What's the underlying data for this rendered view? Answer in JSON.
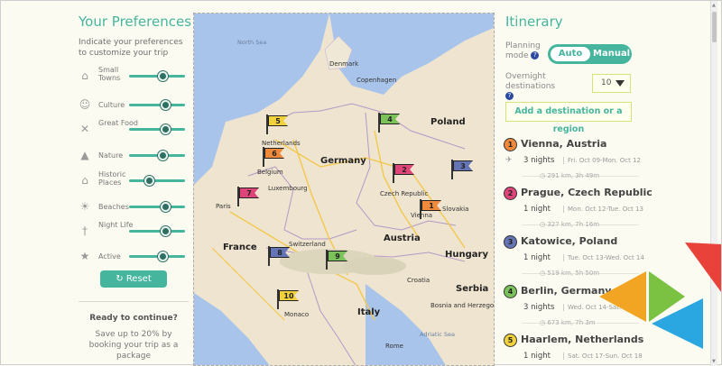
{
  "preferences": {
    "title": "Your Preferences",
    "intro": "Indicate your preferences to customize your trip",
    "items": [
      {
        "label": "Small Towns",
        "icon": "house-icon",
        "level": 0.6
      },
      {
        "label": "Culture",
        "icon": "theater-masks-icon",
        "level": 0.65
      },
      {
        "label": "Great Food",
        "icon": "fork-knife-icon",
        "level": 0.65
      },
      {
        "label": "Nature",
        "icon": "tree-icon",
        "level": 0.6
      },
      {
        "label": "Historic Places",
        "icon": "temple-icon",
        "level": 0.35
      },
      {
        "label": "Beaches",
        "icon": "beach-icon",
        "level": 0.65
      },
      {
        "label": "Night Life",
        "icon": "cocktail-icon",
        "level": 0.65
      },
      {
        "label": "Active",
        "icon": "hiking-icon",
        "level": 0.6
      }
    ],
    "reset_label": "Reset",
    "ready_title": "Ready to continue?",
    "ready_text": "Save up to 20% by booking your trip as a package"
  },
  "map": {
    "labels": {
      "north_sea": "North Sea",
      "denmark": "Denmark",
      "copenhagen": "Copenhagen",
      "poland": "Poland",
      "germany": "Germany",
      "netherlands": "Netherlands",
      "belgium": "Belgium",
      "luxembourg": "Luxembourg",
      "czech": "Czech Republic",
      "slovakia": "Slovakia",
      "france": "France",
      "switzerland": "Switzerland",
      "austria": "Austria",
      "italy": "Italy",
      "vienna": "Vienna",
      "hungary": "Hungary",
      "croatia": "Croatia",
      "bosnia": "Bosnia and Herzegovina",
      "serbia": "Serbia",
      "monaco": "Monaco",
      "rome": "Rome",
      "adriatic": "Adriatic Sea",
      "paris": "Paris"
    },
    "flags": [
      {
        "n": "1",
        "color": "#f08a3a"
      },
      {
        "n": "2",
        "color": "#e0457a"
      },
      {
        "n": "3",
        "color": "#6474b5"
      },
      {
        "n": "4",
        "color": "#7bc25a"
      },
      {
        "n": "5",
        "color": "#f2d23c"
      },
      {
        "n": "6",
        "color": "#f08a3a"
      },
      {
        "n": "7",
        "color": "#e0457a"
      },
      {
        "n": "8",
        "color": "#6474b5"
      },
      {
        "n": "9",
        "color": "#7bc25a"
      },
      {
        "n": "10",
        "color": "#f2d23c"
      }
    ]
  },
  "itinerary": {
    "title": "Itinerary",
    "planning_mode_label": "Planning mode",
    "mode_auto": "Auto",
    "mode_manual": "Manual",
    "overnight_label": "Overnight destinations",
    "overnight_value": "10",
    "add_destination": "Add a destination or a region",
    "destinations": [
      {
        "n": "1",
        "color": "#f08a3a",
        "name": "Vienna, Austria",
        "nights": "3 nights",
        "dates": "Fri. Oct 09-Mon. Oct 12",
        "dist": "291 km, 3h 49m"
      },
      {
        "n": "2",
        "color": "#e0457a",
        "name": "Prague, Czech Republic",
        "nights": "1 night",
        "dates": "Mon. Oct 12-Tue. Oct 13",
        "dist": "327 km, 7h 16m"
      },
      {
        "n": "3",
        "color": "#6474b5",
        "name": "Katowice, Poland",
        "nights": "1 night",
        "dates": "Tue. Oct 13-Wed. Oct 14",
        "dist": "519 km, 5h 50m"
      },
      {
        "n": "4",
        "color": "#7bc25a",
        "name": "Berlin, Germany",
        "nights": "3 nights",
        "dates": "Wed. Oct 14-Sat. Oct 17",
        "dist": "673 km, 7h 3m"
      },
      {
        "n": "5",
        "color": "#f2d23c",
        "name": "Haarlem, Netherlands",
        "nights": "1 night",
        "dates": "Sat. Oct 17-Sun. Oct 18",
        "dist": ""
      }
    ]
  },
  "colors": {
    "accent": "#46b59e",
    "logo_red": "#e8423a",
    "logo_orange": "#f2a523",
    "logo_green": "#7bc142",
    "logo_blue": "#2aa7e0"
  }
}
